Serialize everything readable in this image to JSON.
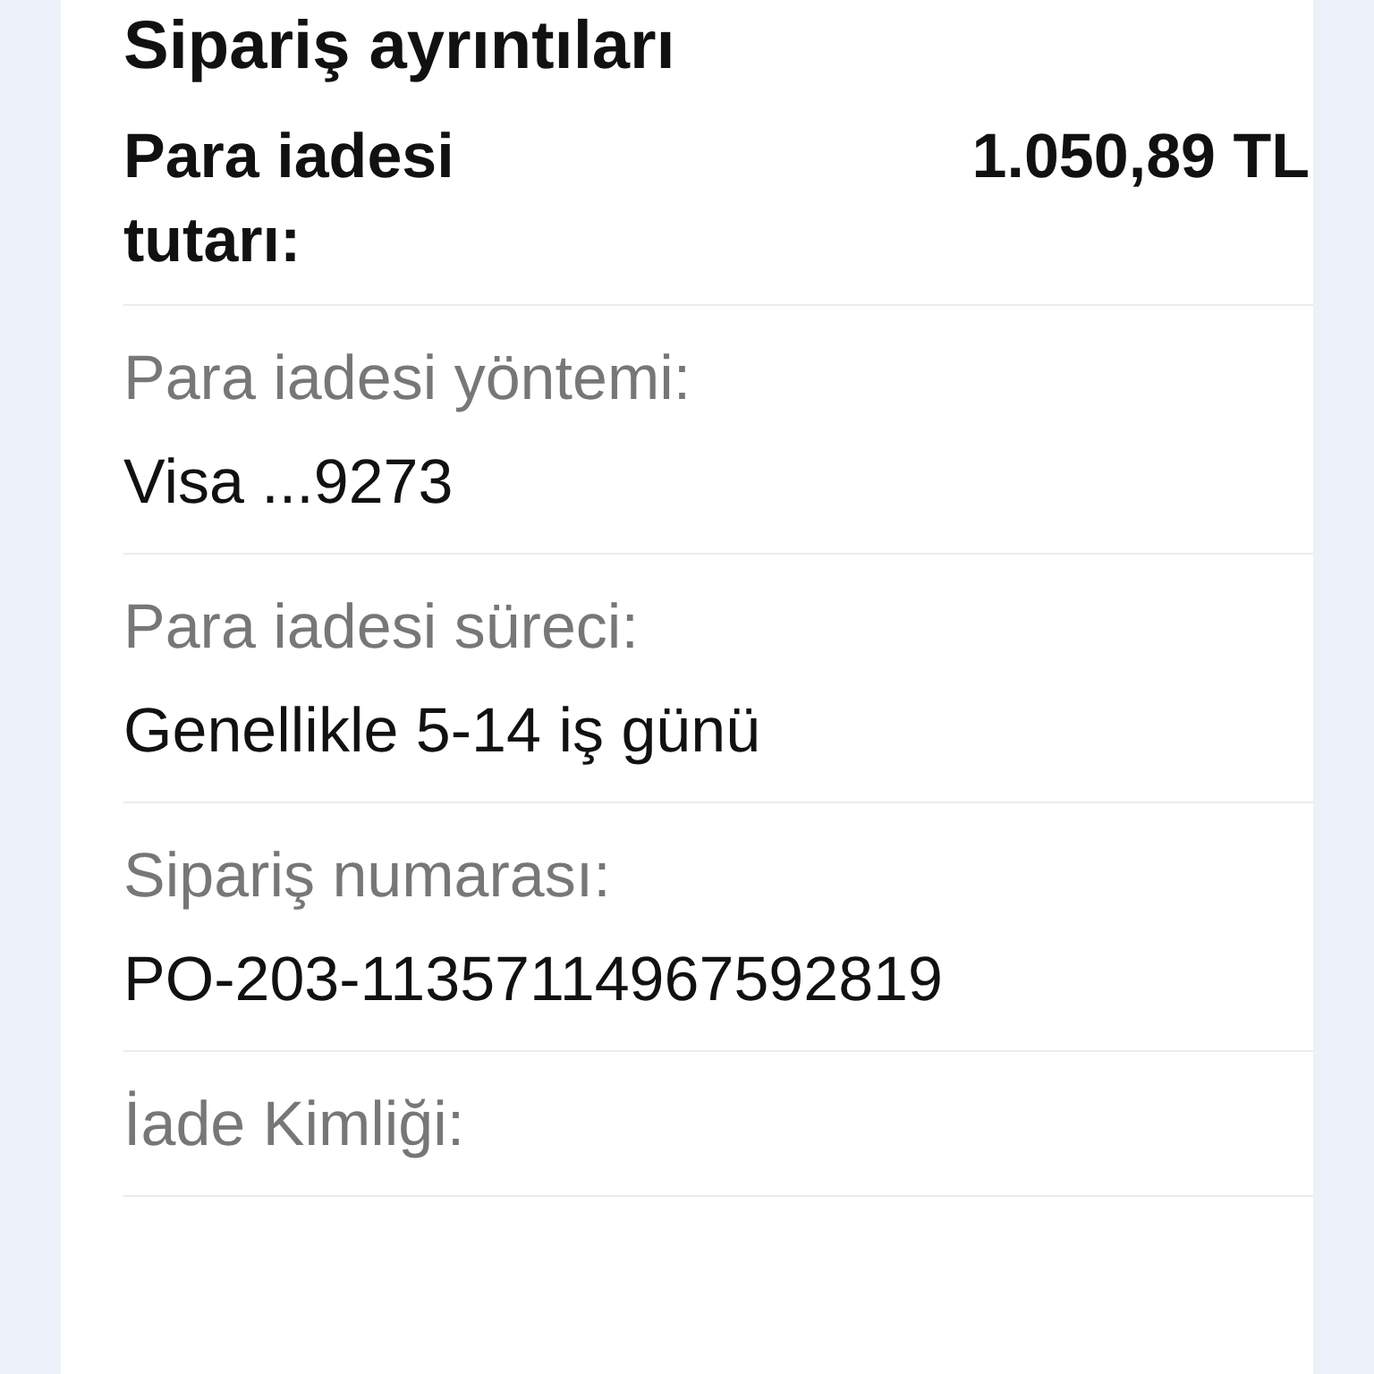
{
  "title": "Sipariş ayrıntıları",
  "refund_amount": {
    "label": "Para iadesi tutarı:",
    "value": "1.050,89 TL"
  },
  "details": [
    {
      "label": "Para iadesi yöntemi:",
      "value": "Visa ...9273"
    },
    {
      "label": "Para iadesi süreci:",
      "value": "Genellikle 5-14 iş günü"
    },
    {
      "label": "Sipariş numarası:",
      "value": "PO-203-11357114967592819"
    },
    {
      "label": "İade Kimliği:"
    }
  ]
}
